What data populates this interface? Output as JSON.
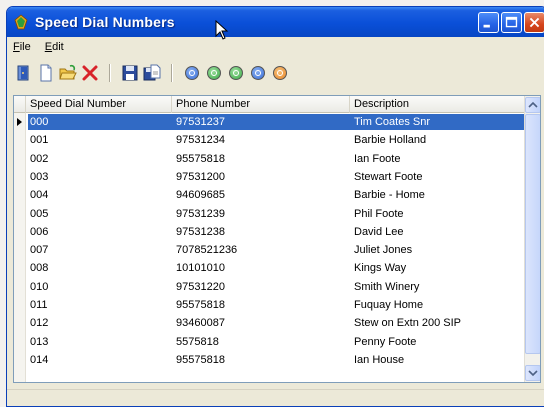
{
  "window": {
    "title": "Speed Dial Numbers"
  },
  "menu": {
    "file_label": "File",
    "file_mnemonic": "F",
    "file_rest": "ile",
    "edit_label": "Edit",
    "edit_mnemonic": "E",
    "edit_rest": "dit"
  },
  "toolbar": {
    "icons": [
      "exit-door-icon",
      "new-document-icon",
      "open-folder-icon",
      "delete-x-icon",
      "save-disk-icon",
      "save-as-icon",
      "nav-first-icon",
      "nav-prev-icon",
      "nav-next-icon",
      "nav-last-icon",
      "nav-refresh-icon"
    ],
    "circle_colors": [
      "#3a6fd8",
      "#3aa845",
      "#3aa845",
      "#3a6fd8",
      "#e6862a"
    ]
  },
  "grid": {
    "columns": [
      "Speed Dial Number",
      "Phone Number",
      "Description"
    ],
    "selected_row": 0,
    "rows": [
      [
        "000",
        "97531237",
        "Tim Coates Snr"
      ],
      [
        "001",
        "97531234",
        "Barbie Holland"
      ],
      [
        "002",
        "95575818",
        "Ian Foote"
      ],
      [
        "003",
        "97531200",
        "Stewart Foote"
      ],
      [
        "004",
        "94609685",
        "Barbie - Home"
      ],
      [
        "005",
        "97531239",
        "Phil Foote"
      ],
      [
        "006",
        "97531238",
        "David Lee"
      ],
      [
        "007",
        "7078521236",
        "Juliet Jones"
      ],
      [
        "008",
        "10101010",
        "Kings Way"
      ],
      [
        "010",
        "97531220",
        "Smith Winery"
      ],
      [
        "011",
        "95575818",
        "Fuquay Home"
      ],
      [
        "012",
        "93460087",
        "Stew on Extn 200 SIP"
      ],
      [
        "013",
        "5575818",
        "Penny Foote"
      ],
      [
        "014",
        "95575818",
        "Ian House"
      ]
    ]
  },
  "colors": {
    "selection": "#316ac5",
    "titlebar": "#0a4fd8"
  }
}
